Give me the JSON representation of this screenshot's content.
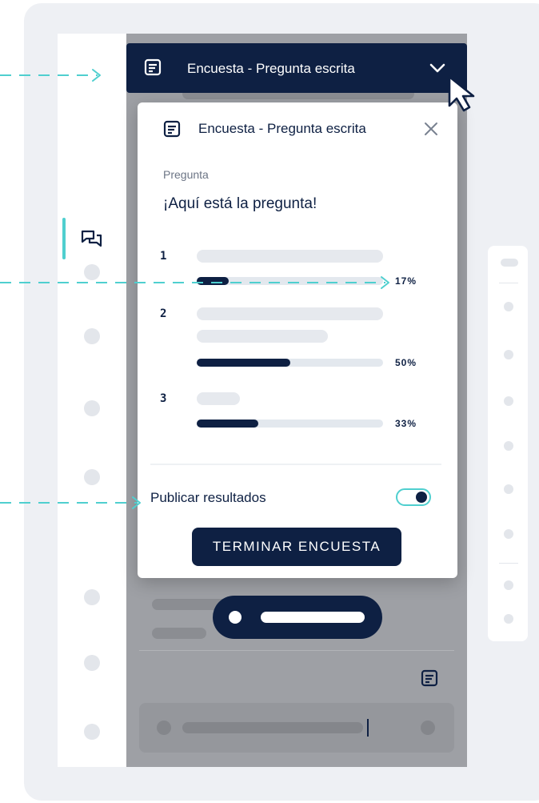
{
  "topbar": {
    "title": "Encuesta - Pregunta escrita",
    "icon": "document-icon",
    "chevron_icon": "chevron-down-icon"
  },
  "card": {
    "title": "Encuesta - Pregunta escrita",
    "close_icon": "close-icon",
    "question_label": "Pregunta",
    "question_text": "¡Aquí está la pregunta!",
    "options": [
      {
        "number": "1",
        "percent_label": "17%",
        "fraction": 0.17
      },
      {
        "number": "2",
        "percent_label": "50%",
        "fraction": 0.5
      },
      {
        "number": "3",
        "percent_label": "33%",
        "fraction": 0.33
      }
    ],
    "publish_label": "Publicar resultados",
    "publish_on": true,
    "end_button_label": "TERMINAR ENCUESTA"
  },
  "colors": {
    "navy": "#0e2043",
    "accent": "#4fcfcf",
    "overlay": "#9ea0a5"
  }
}
